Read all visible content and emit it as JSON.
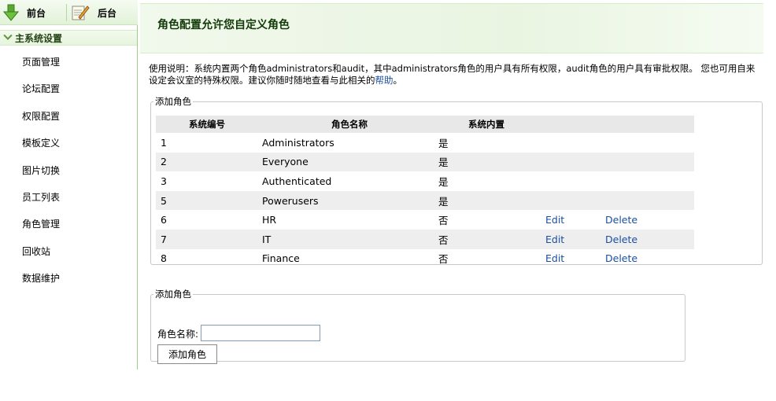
{
  "sidebar": {
    "front_tab": "前台",
    "back_tab": "后台",
    "section_title": "主系统设置",
    "items": [
      {
        "label": "页面管理"
      },
      {
        "label": "论坛配置"
      },
      {
        "label": "权限配置"
      },
      {
        "label": "模板定义"
      },
      {
        "label": "图片切换"
      },
      {
        "label": "员工列表"
      },
      {
        "label": "角色管理"
      },
      {
        "label": "回收站"
      },
      {
        "label": "数据维护"
      }
    ]
  },
  "header": {
    "title": "角色配置允许您自定义角色"
  },
  "usage": {
    "text": "使用说明：系统内置两个角色administrators和audit，其中administrators角色的用户具有所有权限，audit角色的用户具有审批权限。 您也可用自来设定会议室的特殊权限。建议你随时随地查看与此相关的",
    "help_link": "帮助",
    "end": "。"
  },
  "roles_panel": {
    "legend": "添加角色",
    "columns": [
      "系统编号",
      "角色名称",
      "系统内置"
    ],
    "rows": [
      {
        "id": "1",
        "name": "Administrators",
        "builtin": "是",
        "edit": "",
        "delete": ""
      },
      {
        "id": "2",
        "name": "Everyone",
        "builtin": "是",
        "edit": "",
        "delete": ""
      },
      {
        "id": "3",
        "name": "Authenticated",
        "builtin": "是",
        "edit": "",
        "delete": ""
      },
      {
        "id": "5",
        "name": "Powerusers",
        "builtin": "是",
        "edit": "",
        "delete": ""
      },
      {
        "id": "6",
        "name": "HR",
        "builtin": "否",
        "edit": "Edit",
        "delete": "Delete"
      },
      {
        "id": "7",
        "name": "IT",
        "builtin": "否",
        "edit": "Edit",
        "delete": "Delete"
      },
      {
        "id": "8",
        "name": "Finance",
        "builtin": "否",
        "edit": "Edit",
        "delete": "Delete"
      }
    ]
  },
  "add_panel": {
    "legend": "添加角色",
    "name_label": "角色名称:",
    "name_value": "",
    "button_label": "添加角色"
  },
  "colors": {
    "accent": "#9fce8a",
    "header_bg": "#e9f5e1",
    "link": "#1a4fa0"
  }
}
